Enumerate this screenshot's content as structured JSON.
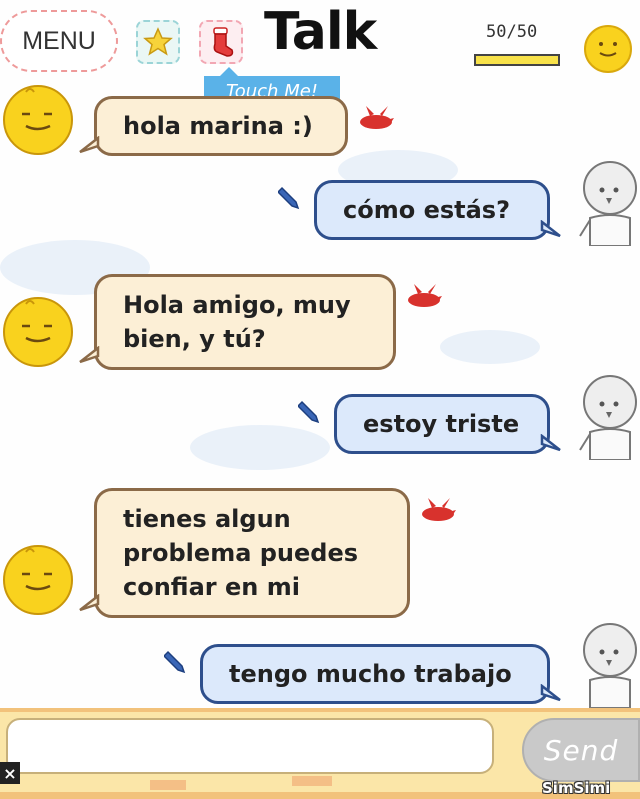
{
  "header": {
    "menu_label": "MENU",
    "star_icon": "star-icon",
    "gift_icon": "stocking-icon",
    "title": "Talk",
    "tooltip": "Touch Me!",
    "energy_text": "50/50",
    "energy_fraction": 1.0
  },
  "messages": [
    {
      "sender": "bot",
      "lines": [
        "hola marina :)"
      ]
    },
    {
      "sender": "user",
      "lines": [
        "cómo estás?"
      ]
    },
    {
      "sender": "bot",
      "lines": [
        "Hola amigo, muy",
        "bien, y tú?"
      ]
    },
    {
      "sender": "user",
      "lines": [
        "estoy triste"
      ]
    },
    {
      "sender": "bot",
      "lines": [
        "tienes algun",
        "problema puedes",
        "confiar en mi"
      ]
    },
    {
      "sender": "user",
      "lines": [
        "tengo mucho trabajo"
      ]
    }
  ],
  "composer": {
    "placeholder": "",
    "send_label": "Send",
    "brand": "SimSimi",
    "close_label": "×"
  },
  "colors": {
    "bot_bubble": "#fcefd6",
    "user_bubble": "#dce9fb",
    "accent_blue": "#5ab2e8",
    "simsimi_yellow": "#f9d21e"
  }
}
